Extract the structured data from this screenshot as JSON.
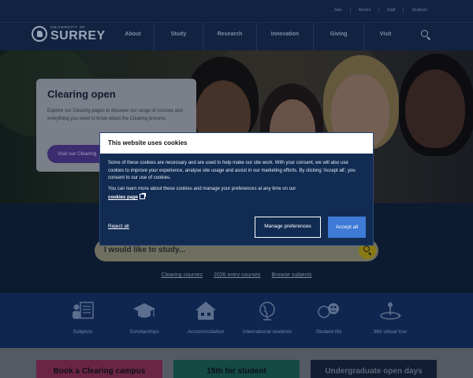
{
  "utility_links": [
    "Jobs",
    "Alumni",
    "Staff",
    "Students"
  ],
  "header": {
    "logo_small": "UNIVERSITY OF",
    "logo_big": "SURREY",
    "nav": [
      "About",
      "Study",
      "Research",
      "Innovation",
      "Giving",
      "Visit"
    ]
  },
  "hero": {
    "title": "Clearing open",
    "text": "Explore our Clearing pages to discover our range of courses and everything you need to know about the Clearing process.",
    "button": "Visit our Clearing"
  },
  "study_search": {
    "placeholder": "I would like to study...",
    "links": [
      "Clearing courses",
      "2026 entry courses",
      "Browse subjects"
    ]
  },
  "icon_tiles": [
    {
      "icon": "subjects-icon",
      "label": "Subjects"
    },
    {
      "icon": "graduation-cap-icon",
      "label": "Scholarships"
    },
    {
      "icon": "house-icon",
      "label": "Accommodation"
    },
    {
      "icon": "globe-icon",
      "label": "International students"
    },
    {
      "icon": "student-life-icon",
      "label": "Student life"
    },
    {
      "icon": "virtual-tour-icon",
      "label": "360 virtual tour"
    }
  ],
  "bottom_cards": [
    {
      "label": "Book a Clearing campus",
      "color": "#b23a6c"
    },
    {
      "label": "15th for student",
      "color": "#1f7a6a"
    },
    {
      "label": "Undergraduate open days",
      "color": "#1d2f55"
    }
  ],
  "cookie": {
    "title": "This website uses cookies",
    "body": "Some of these cookies are necessary and are used to help make our site work. With your consent, we will also use cookies to improve your experience, analyse site usage and assist in our marketing efforts. By clicking 'Accept all', you consent to our use of cookies.",
    "body2": "You can learn more about these cookies and manage your preferences at any time on our",
    "link": "cookies page",
    "reject": "Reject all",
    "manage": "Manage preferences",
    "accept": "Accept all"
  },
  "colors": {
    "navy": "#112340",
    "accent_blue": "#3e7ad6",
    "yellow": "#8a7a14"
  }
}
